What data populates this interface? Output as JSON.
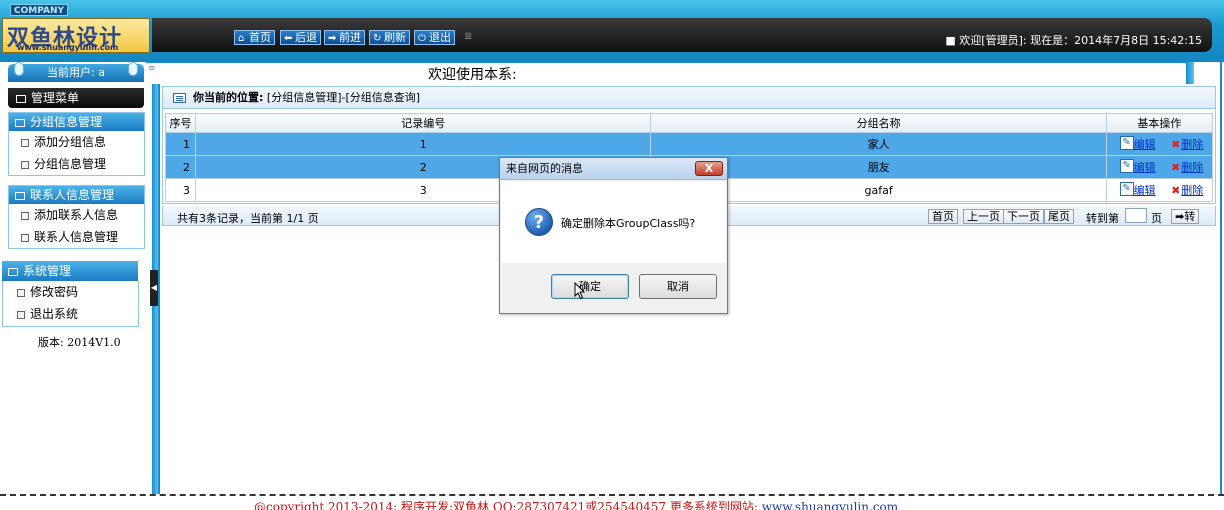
{
  "header": {
    "company": "COMPANY",
    "logo_text": "双鱼林设计",
    "logo_url": "www.shuangyulin.com",
    "nav": [
      {
        "label": "首页",
        "icon": "home-icon"
      },
      {
        "label": "后退",
        "icon": "arrow-left-icon"
      },
      {
        "label": "前进",
        "icon": "arrow-right-icon"
      },
      {
        "label": "刷新",
        "icon": "refresh-icon"
      },
      {
        "label": "退出",
        "icon": "power-icon"
      }
    ],
    "welcome": "■ 欢迎[管理员]: ",
    "now_label": " 现在是：",
    "datetime": "2014年7月8日 15:42:15"
  },
  "sidebar": {
    "current_user": "当前用户: a",
    "menu_title": "管理菜单",
    "groups": [
      {
        "title": "分组信息管理",
        "items": [
          "添加分组信息",
          "分组信息管理"
        ]
      },
      {
        "title": "联系人信息管理",
        "items": [
          "添加联系人信息",
          "联系人信息管理"
        ]
      }
    ],
    "system": {
      "title": "系统管理",
      "items": [
        "修改密码",
        "退出系统"
      ]
    },
    "version": "版本: 2014V1.0"
  },
  "main": {
    "welcome_title": "欢迎使用本系:",
    "location_label": "你当前的位置:",
    "location_path": "[分组信息管理]-[分组信息查询]",
    "table": {
      "columns": [
        "序号",
        "记录编号",
        "分组名称",
        "基本操作"
      ],
      "rows": [
        {
          "idx": "1",
          "id": "1",
          "name": "家人",
          "selected": true
        },
        {
          "idx": "2",
          "id": "2",
          "name": "朋友",
          "selected": true
        },
        {
          "idx": "3",
          "id": "3",
          "name": "gafaf",
          "selected": false
        }
      ],
      "edit_label": "编辑",
      "delete_label": "删除"
    },
    "pager": {
      "summary": "共有3条记录，当前第 1/1 页",
      "first": "首页",
      "prev": "上一页",
      "next": "下一页",
      "last": "尾页",
      "goto_prefix": "转到第",
      "goto_suffix": "页",
      "go": "➡转"
    }
  },
  "dialog": {
    "title": "来自网页的消息",
    "close": "X",
    "message": "确定删除本GroupClass吗?",
    "ok": "确定",
    "cancel": "取消"
  },
  "footer": {
    "text": "@copyright 2013-2014: 程序开发:双鱼林  QQ:287307421或254540457  更多系统到网站: ",
    "link": "www.shuangyulin.com"
  }
}
